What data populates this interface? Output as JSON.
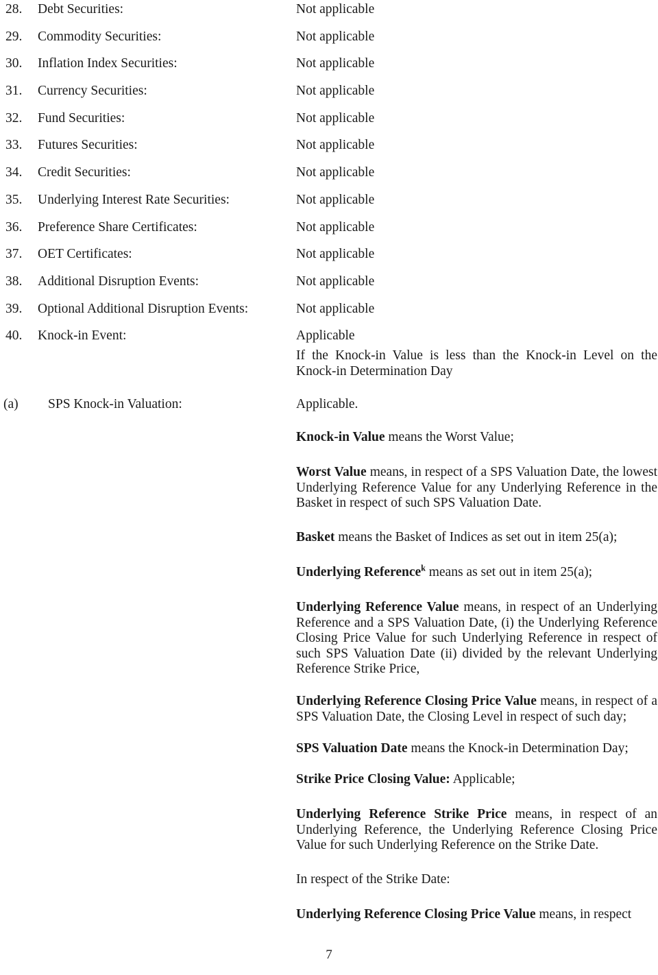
{
  "document": {
    "page_number": "7",
    "items": [
      {
        "number": "28.",
        "label": "Debt Securities:",
        "value": "Not applicable"
      },
      {
        "number": "29.",
        "label": "Commodity Securities:",
        "value": "Not applicable"
      },
      {
        "number": "30.",
        "label": "Inflation Index Securities:",
        "value": "Not applicable"
      },
      {
        "number": "31.",
        "label": "Currency Securities:",
        "value": "Not applicable"
      },
      {
        "number": "32.",
        "label": "Fund Securities:",
        "value": "Not applicable"
      },
      {
        "number": "33.",
        "label": "Futures Securities:",
        "value": "Not applicable"
      },
      {
        "number": "34.",
        "label": "Credit Securities:",
        "value": "Not applicable"
      },
      {
        "number": "35.",
        "label": "Underlying Interest Rate Securities:",
        "value": "Not applicable"
      },
      {
        "number": "36.",
        "label": "Preference Share Certificates:",
        "value": "Not applicable"
      },
      {
        "number": "37.",
        "label": "OET Certificates:",
        "value": "Not applicable"
      },
      {
        "number": "38.",
        "label": "Additional Disruption Events:",
        "value": "Not applicable"
      },
      {
        "number": "39.",
        "label": "Optional Additional Disruption Events:",
        "value": "Not applicable"
      },
      {
        "number": "40.",
        "label": "Knock-in Event:",
        "value": "Applicable"
      }
    ],
    "knock_in_condition": "If the Knock-in Value is less than the Knock-in Level on the Knock-in Determination Day",
    "sub_item": {
      "marker": "(a)",
      "label": "SPS Knock-in Valuation:",
      "value": "Applicable."
    },
    "definitions": {
      "knock_in_value": {
        "term": "Knock-in Value",
        "body": " means the Worst Value;"
      },
      "worst_value": {
        "term": "Worst Value",
        "body": " means, in respect of a SPS Valuation Date, the lowest Underlying Reference Value for any Underlying Reference in the Basket in respect of such SPS Valuation Date."
      },
      "basket": {
        "term": "Basket",
        "body": " means the Basket of Indices as set out in item 25(a);"
      },
      "underlying_reference": {
        "term": "Underlying Reference",
        "superscript": "k",
        "body": " means as set out in item 25(a);"
      },
      "underlying_reference_value": {
        "term": "Underlying Reference Value",
        "body": " means, in respect of an Underlying Reference and a SPS Valuation Date, (i) the Underlying Reference Closing Price Value for such Underlying Reference in respect of such SPS Valuation Date (ii) divided by the relevant Underlying Reference Strike Price,"
      },
      "underlying_reference_closing_price_value": {
        "term": "Underlying Reference Closing Price Value",
        "body": " means, in respect of a SPS Valuation Date, the Closing Level in respect of such day;"
      },
      "sps_valuation_date": {
        "term": "SPS Valuation Date",
        "body": " means the Knock-in Determination Day;"
      },
      "strike_price_closing_value": {
        "term": "Strike Price Closing Value:",
        "body": " Applicable;"
      },
      "underlying_reference_strike_price": {
        "term": "Underlying Reference Strike Price",
        "body": " means, in respect of an Underlying Reference, the Underlying Reference Closing Price Value for such Underlying Reference on the Strike Date."
      },
      "strike_date_intro": "In respect of the Strike Date:",
      "underlying_reference_closing_price_value_2": {
        "term": "Underlying Reference Closing Price Value",
        "body": " means, in respect"
      }
    }
  }
}
